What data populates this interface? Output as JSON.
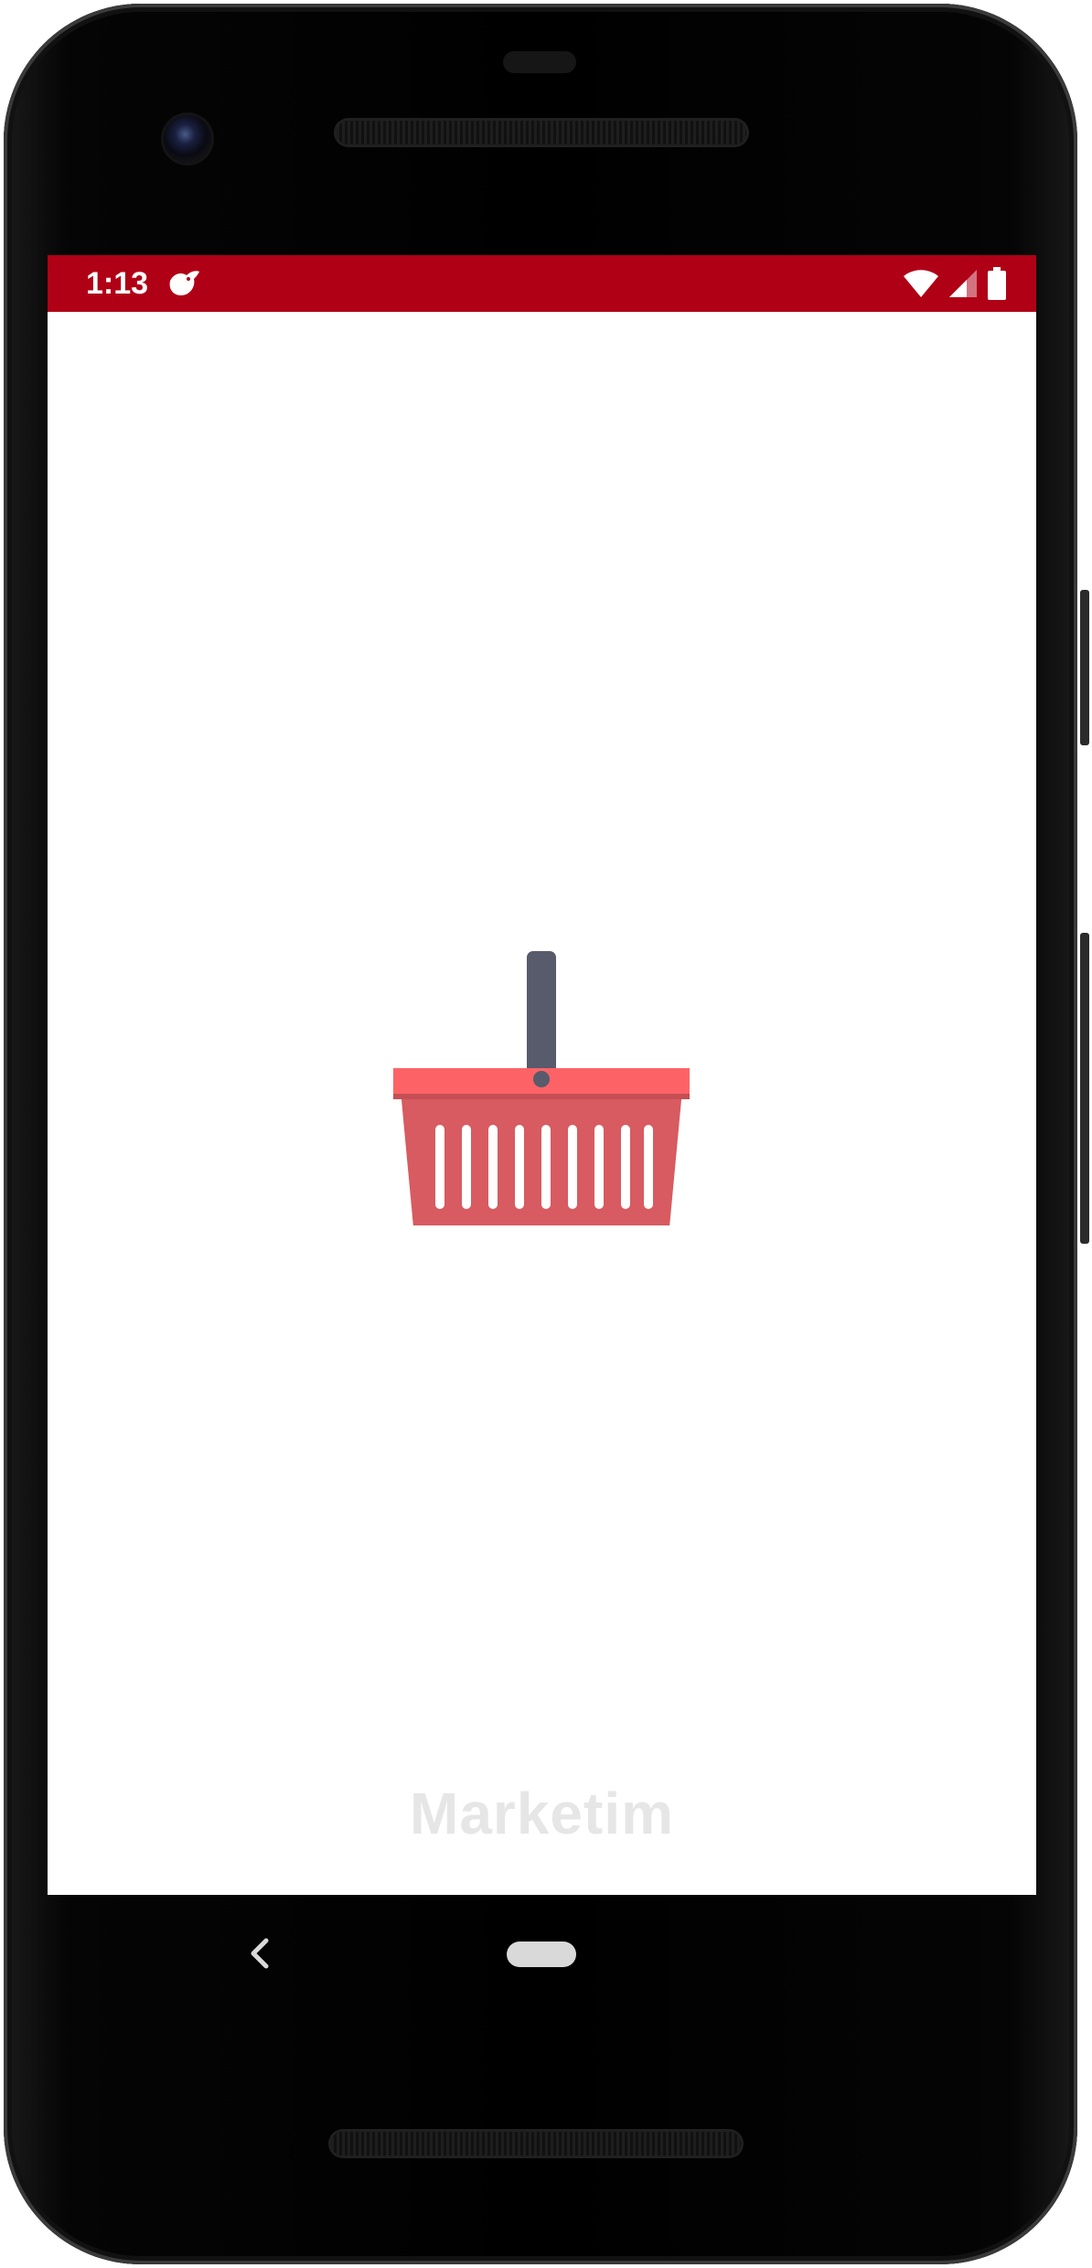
{
  "status_bar": {
    "time": "1:13",
    "background_color": "#b00016",
    "notification_icon": "bird-icon",
    "icons": [
      "wifi-icon",
      "signal-icon",
      "battery-icon"
    ]
  },
  "splash": {
    "logo_icon": "shopping-basket-icon",
    "app_name": "Marketim",
    "basket_colors": {
      "rim": "#fd6366",
      "body": "#d75b60",
      "handle": "#575b6b"
    }
  },
  "nav_bar": {
    "back_icon": "back-chevron-icon",
    "home_icon": "home-pill-icon"
  }
}
